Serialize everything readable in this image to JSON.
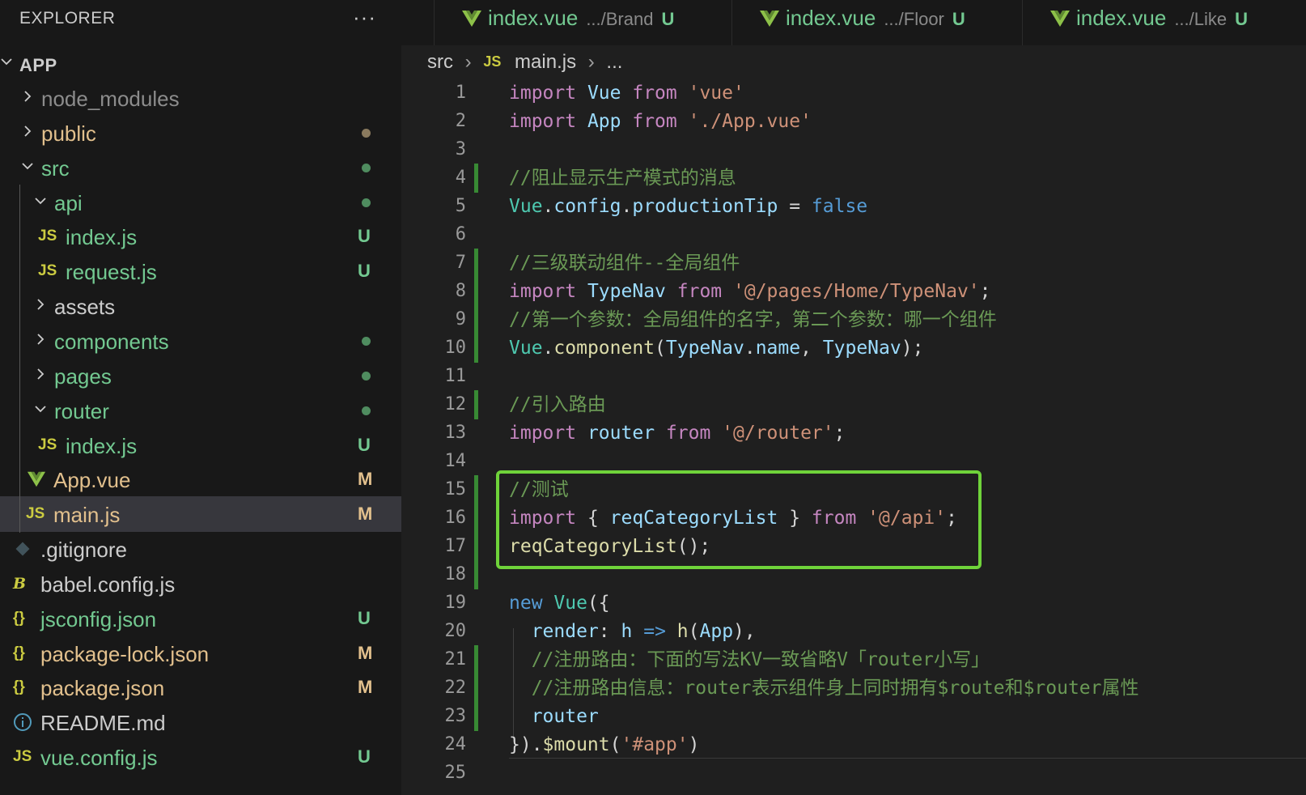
{
  "explorer": {
    "title": "EXPLORER",
    "more": "···",
    "root": "APP",
    "items": [
      {
        "label": "node_modules",
        "kind": "folder",
        "expanded": false,
        "depth": 1,
        "color": "gray",
        "badge": "",
        "dot": ""
      },
      {
        "label": "public",
        "kind": "folder",
        "expanded": false,
        "depth": 1,
        "color": "yellow",
        "badge": "",
        "dot": "#8a7a5e"
      },
      {
        "label": "src",
        "kind": "folder",
        "expanded": true,
        "depth": 1,
        "color": "green",
        "badge": "",
        "dot": "#4f8c5f"
      },
      {
        "label": "api",
        "kind": "folder",
        "expanded": true,
        "depth": 2,
        "color": "green",
        "badge": "",
        "dot": "#4f8c5f"
      },
      {
        "label": "index.js",
        "kind": "js",
        "depth": 3,
        "color": "green",
        "badge": "U",
        "dot": ""
      },
      {
        "label": "request.js",
        "kind": "js",
        "depth": 3,
        "color": "green",
        "badge": "U",
        "dot": ""
      },
      {
        "label": "assets",
        "kind": "folder",
        "expanded": false,
        "depth": 2,
        "color": "white",
        "badge": "",
        "dot": ""
      },
      {
        "label": "components",
        "kind": "folder",
        "expanded": false,
        "depth": 2,
        "color": "green",
        "badge": "",
        "dot": "#4f8c5f"
      },
      {
        "label": "pages",
        "kind": "folder",
        "expanded": false,
        "depth": 2,
        "color": "green",
        "badge": "",
        "dot": "#4f8c5f"
      },
      {
        "label": "router",
        "kind": "folder",
        "expanded": true,
        "depth": 2,
        "color": "green",
        "badge": "",
        "dot": "#4f8c5f"
      },
      {
        "label": "index.js",
        "kind": "js",
        "depth": 3,
        "color": "green",
        "badge": "U",
        "dot": ""
      },
      {
        "label": "App.vue",
        "kind": "vue",
        "depth": 2,
        "color": "yellow",
        "badge": "M",
        "dot": ""
      },
      {
        "label": "main.js",
        "kind": "js",
        "depth": 2,
        "color": "yellow",
        "badge": "M",
        "dot": "",
        "selected": true
      },
      {
        "label": ".gitignore",
        "kind": "git",
        "depth": 1,
        "color": "white",
        "badge": "",
        "dot": ""
      },
      {
        "label": "babel.config.js",
        "kind": "babel",
        "depth": 1,
        "color": "white",
        "badge": "",
        "dot": ""
      },
      {
        "label": "jsconfig.json",
        "kind": "json",
        "depth": 1,
        "color": "green",
        "badge": "U",
        "dot": ""
      },
      {
        "label": "package-lock.json",
        "kind": "json",
        "depth": 1,
        "color": "yellow",
        "badge": "M",
        "dot": ""
      },
      {
        "label": "package.json",
        "kind": "json",
        "depth": 1,
        "color": "yellow",
        "badge": "M",
        "dot": ""
      },
      {
        "label": "README.md",
        "kind": "info",
        "depth": 1,
        "color": "white",
        "badge": "",
        "dot": ""
      },
      {
        "label": "vue.config.js",
        "kind": "js",
        "depth": 1,
        "color": "green",
        "badge": "U",
        "dot": ""
      }
    ]
  },
  "icons": {
    "js": "JS",
    "json": "{}",
    "babel": "B",
    "info": "i"
  },
  "tabs": [
    {
      "name": "index.vue",
      "path": ".../Brand",
      "badge": "U"
    },
    {
      "name": "index.vue",
      "path": ".../Floor",
      "badge": "U"
    },
    {
      "name": "index.vue",
      "path": ".../Like",
      "badge": "U"
    }
  ],
  "breadcrumb": {
    "folder": "src",
    "icon": "JS",
    "file": "main.js",
    "rest": "..."
  },
  "code_lines": [
    [
      [
        "kw",
        "import"
      ],
      [
        "p",
        " "
      ],
      [
        "var",
        "Vue"
      ],
      [
        "p",
        " "
      ],
      [
        "kw",
        "from"
      ],
      [
        "p",
        " "
      ],
      [
        "str",
        "'vue'"
      ]
    ],
    [
      [
        "kw",
        "import"
      ],
      [
        "p",
        " "
      ],
      [
        "var",
        "App"
      ],
      [
        "p",
        " "
      ],
      [
        "kw",
        "from"
      ],
      [
        "p",
        " "
      ],
      [
        "str",
        "'./App.vue'"
      ]
    ],
    [],
    [
      [
        "cmt",
        "//阻止显示生产模式的消息"
      ]
    ],
    [
      [
        "cls",
        "Vue"
      ],
      [
        "p",
        "."
      ],
      [
        "var",
        "config"
      ],
      [
        "p",
        "."
      ],
      [
        "var",
        "productionTip"
      ],
      [
        "p",
        " = "
      ],
      [
        "bool",
        "false"
      ]
    ],
    [],
    [
      [
        "cmt",
        "//三级联动组件--全局组件"
      ]
    ],
    [
      [
        "kw",
        "import"
      ],
      [
        "p",
        " "
      ],
      [
        "var",
        "TypeNav"
      ],
      [
        "p",
        " "
      ],
      [
        "kw",
        "from"
      ],
      [
        "p",
        " "
      ],
      [
        "str",
        "'@/pages/Home/TypeNav'"
      ],
      [
        "p",
        ";"
      ]
    ],
    [
      [
        "cmt",
        "//第一个参数：全局组件的名字，第二个参数：哪一个组件"
      ]
    ],
    [
      [
        "cls",
        "Vue"
      ],
      [
        "p",
        "."
      ],
      [
        "fn",
        "component"
      ],
      [
        "p",
        "("
      ],
      [
        "var",
        "TypeNav"
      ],
      [
        "p",
        "."
      ],
      [
        "var",
        "name"
      ],
      [
        "p",
        ", "
      ],
      [
        "var",
        "TypeNav"
      ],
      [
        "p",
        ");"
      ]
    ],
    [],
    [
      [
        "cmt",
        "//引入路由"
      ]
    ],
    [
      [
        "kw",
        "import"
      ],
      [
        "p",
        " "
      ],
      [
        "var",
        "router"
      ],
      [
        "p",
        " "
      ],
      [
        "kw",
        "from"
      ],
      [
        "p",
        " "
      ],
      [
        "str",
        "'@/router'"
      ],
      [
        "p",
        ";"
      ]
    ],
    [],
    [
      [
        "cmt",
        "//测试"
      ]
    ],
    [
      [
        "kw",
        "import"
      ],
      [
        "p",
        " { "
      ],
      [
        "var",
        "reqCategoryList"
      ],
      [
        "p",
        " } "
      ],
      [
        "kw",
        "from"
      ],
      [
        "p",
        " "
      ],
      [
        "str",
        "'@/api'"
      ],
      [
        "p",
        ";"
      ]
    ],
    [
      [
        "fn",
        "reqCategoryList"
      ],
      [
        "p",
        "();"
      ]
    ],
    [],
    [
      [
        "bool",
        "new"
      ],
      [
        "p",
        " "
      ],
      [
        "cls",
        "Vue"
      ],
      [
        "p",
        "({"
      ]
    ],
    [
      [
        "p",
        "  "
      ],
      [
        "var",
        "render"
      ],
      [
        "p",
        ": "
      ],
      [
        "var",
        "h"
      ],
      [
        "p",
        " "
      ],
      [
        "bool",
        "=>"
      ],
      [
        "p",
        " "
      ],
      [
        "fn",
        "h"
      ],
      [
        "p",
        "("
      ],
      [
        "var",
        "App"
      ],
      [
        "p",
        "),"
      ]
    ],
    [
      [
        "p",
        "  "
      ],
      [
        "cmt",
        "//注册路由：下面的写法KV一致省略V「router小写」"
      ]
    ],
    [
      [
        "p",
        "  "
      ],
      [
        "cmt",
        "//注册路由信息：router表示组件身上同时拥有$route和$router属性"
      ]
    ],
    [
      [
        "p",
        "  "
      ],
      [
        "var",
        "router"
      ]
    ],
    [
      [
        "p",
        "})."
      ],
      [
        "fn",
        "$mount"
      ],
      [
        "p",
        "("
      ],
      [
        "str",
        "'#app'"
      ],
      [
        "p",
        ")"
      ]
    ],
    []
  ],
  "line_numbers": [
    "1",
    "2",
    "3",
    "4",
    "5",
    "6",
    "7",
    "8",
    "9",
    "10",
    "11",
    "12",
    "13",
    "14",
    "15",
    "16",
    "17",
    "18",
    "19",
    "20",
    "21",
    "22",
    "23",
    "24",
    "25"
  ]
}
